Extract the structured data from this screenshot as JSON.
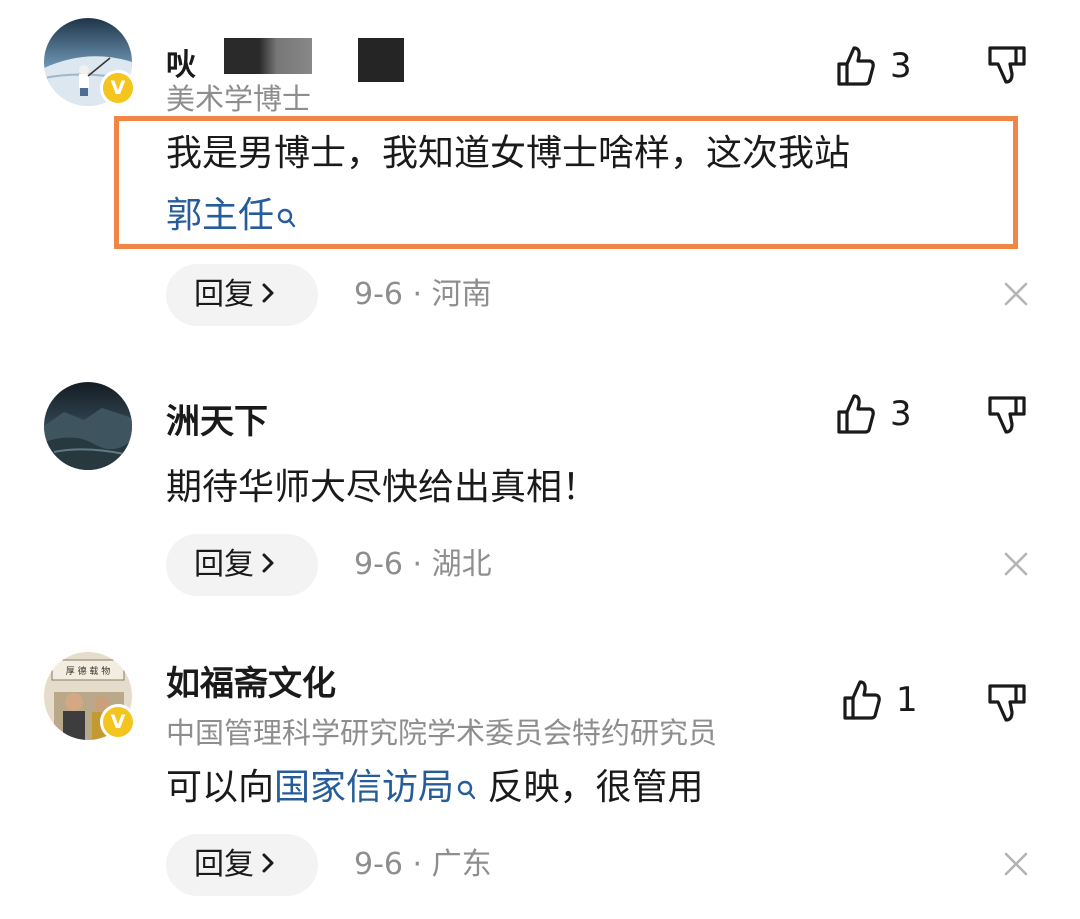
{
  "comments": [
    {
      "username_fragment": "吙",
      "subtitle": "美术学博士",
      "verified": true,
      "text_line1": "我是男博士，我知道女博士啥样，这次我站",
      "text_link": "郭主任",
      "likes": "3",
      "reply_label": "回复",
      "meta": "9-6 · 河南"
    },
    {
      "username": "洲天下",
      "verified": false,
      "text": "期待华师大尽快给出真相！",
      "likes": "3",
      "reply_label": "回复",
      "meta": "9-6 · 湖北"
    },
    {
      "username": "如福斋文化",
      "subtitle": "中国管理科学研究院学术委员会特约研究员",
      "verified": true,
      "text_before": "可以向",
      "text_link": "国家信访局",
      "text_after": " 反映，很管用",
      "likes": "1",
      "reply_label": "回复",
      "meta": "9-6 · 广东"
    }
  ],
  "colors": {
    "link": "#255c99",
    "highlight_border": "#f08545",
    "verified_badge": "#f4c41f",
    "secondary_text": "#8e8e8e",
    "reply_bg": "#f3f3f3"
  },
  "icons": {
    "like": "thumbs-up-icon",
    "dislike": "thumbs-down-icon",
    "close": "close-icon",
    "search": "search-icon",
    "chevron": "chevron-right-icon",
    "verified": "verified-badge-icon"
  }
}
